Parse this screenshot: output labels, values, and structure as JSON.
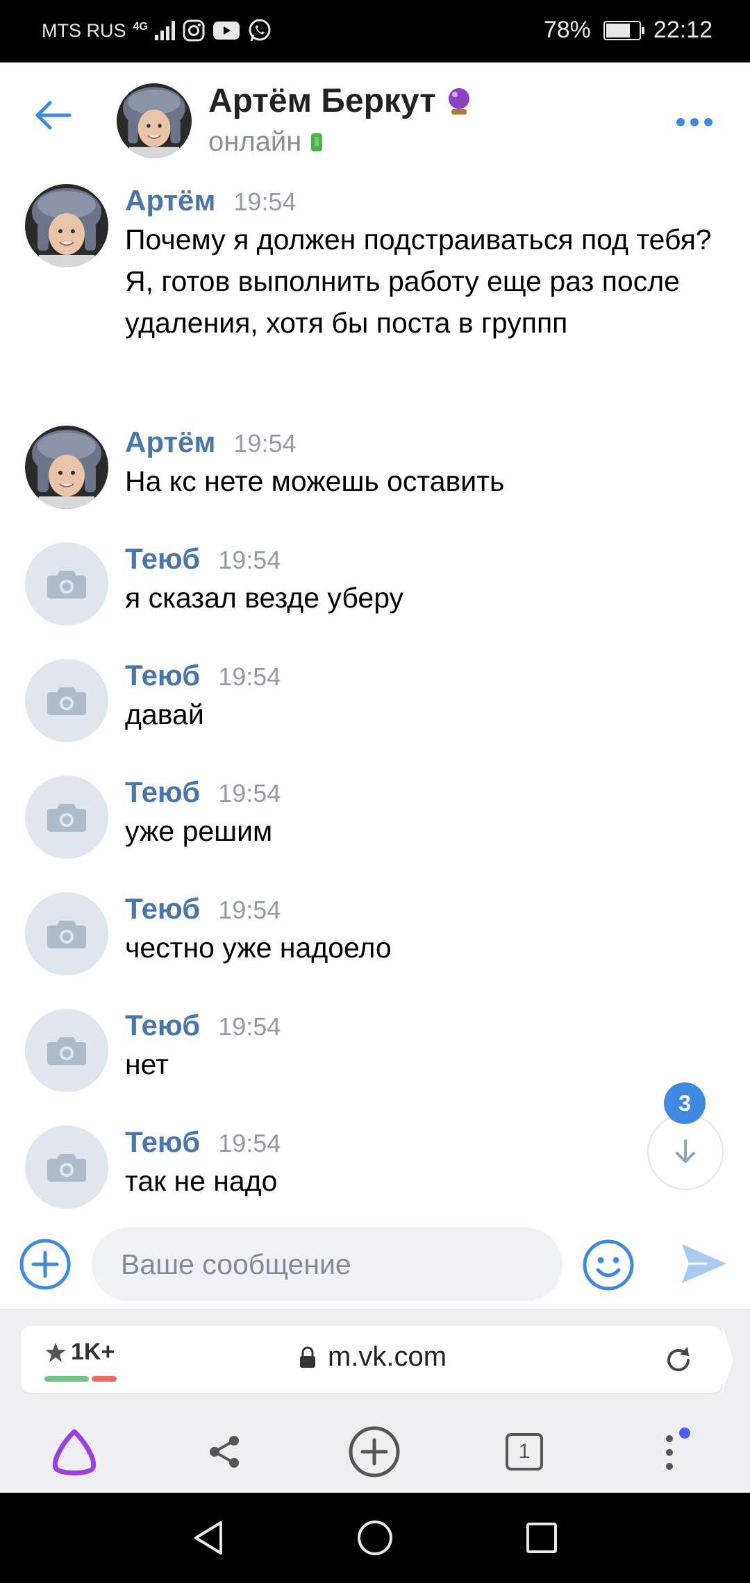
{
  "status_bar": {
    "carrier": "MTS RUS",
    "network": "4G",
    "battery": "78%",
    "battery_level": 0.78,
    "time": "22:12"
  },
  "header": {
    "name": "Артём Беркут",
    "status": "онлайн"
  },
  "messages": [
    {
      "sender": "Артём",
      "time": "19:54",
      "text": "Почему я должен подстраиваться под тебя? Я, готов выполнить работу еще раз после удаления, хотя бы поста в группп",
      "avatar": "photo"
    },
    {
      "sender": "Артём",
      "time": "19:54",
      "text": "На кс нете можешь оставить",
      "avatar": "photo"
    },
    {
      "sender": "Теюб",
      "time": "19:54",
      "text": "я сказал везде уберу",
      "avatar": "camera-placeholder"
    },
    {
      "sender": "Теюб",
      "time": "19:54",
      "text": "давай",
      "avatar": "camera-placeholder"
    },
    {
      "sender": "Теюб",
      "time": "19:54",
      "text": "уже решим",
      "avatar": "camera-placeholder"
    },
    {
      "sender": "Теюб",
      "time": "19:54",
      "text": "честно уже надоело",
      "avatar": "camera-placeholder"
    },
    {
      "sender": "Теюб",
      "time": "19:54",
      "text": "нет",
      "avatar": "camera-placeholder"
    },
    {
      "sender": "Теюб",
      "time": "19:54",
      "text": "так не надо",
      "avatar": "camera-placeholder"
    }
  ],
  "scroll_down": {
    "badge": "3"
  },
  "composer": {
    "placeholder": "Ваше сообщение"
  },
  "browser": {
    "rating": "1K+",
    "url": "m.vk.com",
    "tabs_count": "1"
  },
  "colors": {
    "accent": "#3f8ae0",
    "sender": "#4a76a8",
    "online": "#4bb34b",
    "alice": "#9b3fe0"
  }
}
